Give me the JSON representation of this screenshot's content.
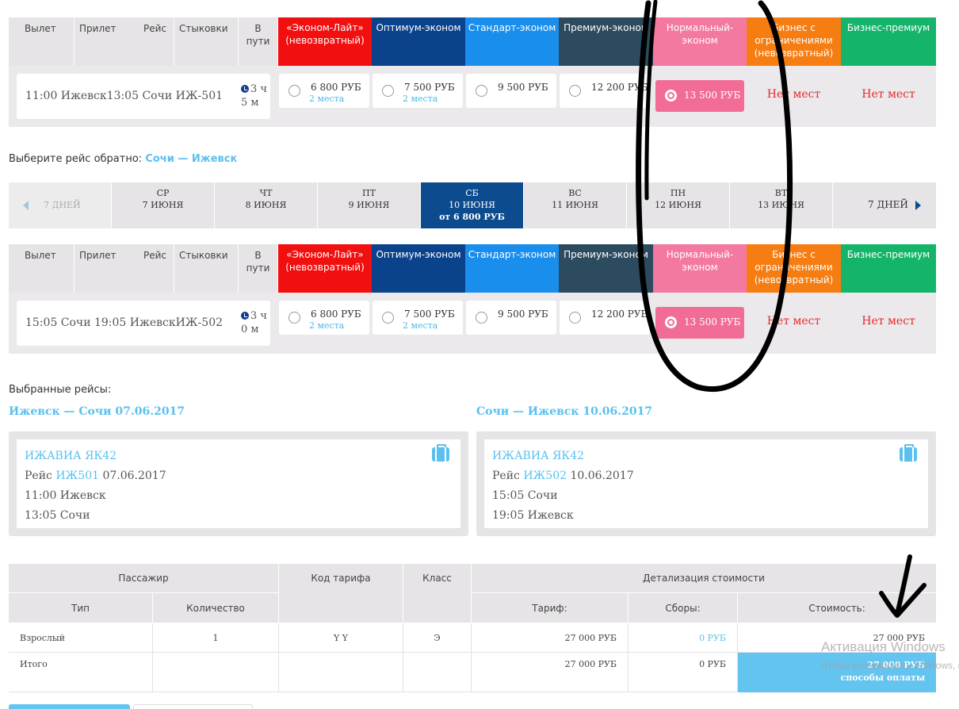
{
  "headers": {
    "departure": "Вылет",
    "arrival": "Прилет",
    "flight": "Рейс",
    "connections": "Стыковки",
    "duration": "В пути"
  },
  "fare_classes": [
    {
      "name": "«Эконом-Лайт» (невозвратный)",
      "color": "#f20f0f"
    },
    {
      "name": "Оптимум-эконом",
      "color": "#0a428c"
    },
    {
      "name": "Стандарт-эконом",
      "color": "#1a8eed"
    },
    {
      "name": "Премиум-эконом",
      "color": "#2d4b5e"
    },
    {
      "name": "Нормальный-эконом",
      "color": "#f479a0"
    },
    {
      "name": "Бизнес с ограничениями (невозвратный)",
      "color": "#f57d12"
    },
    {
      "name": "Бизнес-премиум",
      "color": "#14b56a"
    }
  ],
  "outbound": {
    "times": "11:00 Ижевск13:05 Сочи   ИЖ-501",
    "duration": "3 ч 5 м",
    "fares": [
      {
        "price": "6 800 РУБ",
        "seats": "2 места"
      },
      {
        "price": "7 500 РУБ",
        "seats": "2 места"
      },
      {
        "price": "9 500 РУБ",
        "seats": ""
      },
      {
        "price": "12 200 РУБ",
        "seats": ""
      },
      {
        "price": "13 500 РУБ",
        "seats": ""
      }
    ],
    "no_seats_1": "Нет мест",
    "no_seats_2": "Нет мест"
  },
  "return_prompt": {
    "label": "Выберите рейс обратно:",
    "route": "Сочи — Ижевск"
  },
  "dates": {
    "prev": "7 ДНЕЙ",
    "next": "7 ДНЕЙ",
    "days": [
      {
        "dow": "СР",
        "date": "7 ИЮНЯ",
        "price": ""
      },
      {
        "dow": "ЧТ",
        "date": "8 ИЮНЯ",
        "price": ""
      },
      {
        "dow": "ПТ",
        "date": "9 ИЮНЯ",
        "price": ""
      },
      {
        "dow": "СБ",
        "date": "10 ИЮНЯ",
        "price": "от 6 800 РУБ"
      },
      {
        "dow": "ВС",
        "date": "11 ИЮНЯ",
        "price": ""
      },
      {
        "dow": "ПН",
        "date": "12 ИЮНЯ",
        "price": ""
      },
      {
        "dow": "ВТ",
        "date": "13 ИЮНЯ",
        "price": ""
      }
    ]
  },
  "inbound": {
    "times": "15:05 Сочи 19:05 ИжевскИЖ-502",
    "duration": "3 ч 0 м",
    "fares": [
      {
        "price": "6 800 РУБ",
        "seats": "2 места"
      },
      {
        "price": "7 500 РУБ",
        "seats": "2 места"
      },
      {
        "price": "9 500 РУБ",
        "seats": ""
      },
      {
        "price": "12 200 РУБ",
        "seats": ""
      },
      {
        "price": "13 500 РУБ",
        "seats": ""
      }
    ],
    "no_seats_1": "Нет мест",
    "no_seats_2": "Нет мест"
  },
  "selected": {
    "title": "Выбранные рейсы:",
    "out_heading": "Ижевск — Сочи 07.06.2017",
    "ret_heading": "Сочи — Ижевск 10.06.2017",
    "out": {
      "carrier": "ИЖАВИА ЯК42",
      "flight_label": "Рейс",
      "flight_no": "ИЖ501",
      "flight_date": "07.06.2017",
      "dep": "11:00  Ижевск",
      "arr": "13:05  Сочи"
    },
    "ret": {
      "carrier": "ИЖАВИА ЯК42",
      "flight_label": "Рейс",
      "flight_no": "ИЖ502",
      "flight_date": "10.06.2017",
      "dep": "15:05  Сочи",
      "arr": "19:05  Ижевск"
    }
  },
  "price_table": {
    "passenger": "Пассажир",
    "fare_code": "Код тарифа",
    "class": "Класс",
    "detail": "Детализация стоимости",
    "type": "Тип",
    "quantity": "Количество",
    "tariff": "Тариф:",
    "fees": "Сборы:",
    "cost": "Стоимость:",
    "row": {
      "type": "Взрослый",
      "qty": "1",
      "code": "Y Y",
      "cls": "Э",
      "tariff": "27 000 РУБ",
      "fees": "0 РУБ",
      "cost": "27 000 РУБ"
    },
    "total": {
      "label": "Итого",
      "tariff": "27 000 РУБ",
      "fees": "0 РУБ",
      "cost": "27 000 РУБ",
      "pay": "способы оплаты"
    }
  },
  "watermark": {
    "title": "Активация Windows",
    "sub": "Чтобы активировать Windows, перейдите в раздел «Параметры»."
  }
}
